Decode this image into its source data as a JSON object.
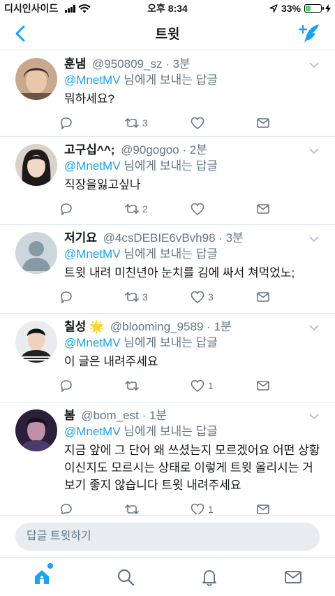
{
  "status_bar": {
    "carrier": "디시인사이드",
    "time": "오후 8:34",
    "battery": "33%",
    "battery_level": 0.33
  },
  "nav": {
    "title": "트윗"
  },
  "tweets": [
    {
      "name": "훈냄",
      "handle": "@950809_sz",
      "time": "· 3분",
      "mention": "@MnetMV",
      "reply_suffix": " 님에게 보내는 답글",
      "body": "뭐하세요?",
      "retweets": "3",
      "likes": ""
    },
    {
      "name": "고구십^^;",
      "handle": "@90gogoo",
      "time": "· 2분",
      "mention": "@MnetMV",
      "reply_suffix": " 님에게 보내는 답글",
      "body": "직장을잃고싶나",
      "retweets": "2",
      "likes": ""
    },
    {
      "name": "저기요",
      "handle": "@4csDEBIE6vBvh98",
      "time": "· 3분",
      "mention": "@MnetMV",
      "reply_suffix": " 님에게 보내는 답글",
      "body": "트윗 내려 미친년아 눈치를 김에 싸서 쳐먹었노;",
      "retweets": "3",
      "likes": "3"
    },
    {
      "name": "칠성 🌟",
      "handle": "@blooming_9589",
      "time": "· 1분",
      "mention": "@MnetMV",
      "reply_suffix": " 님에게 보내는 답글",
      "body": "이 글은 내려주세요",
      "retweets": "",
      "likes": "1"
    },
    {
      "name": "봄",
      "handle": "@bom_est",
      "time": "· 1분",
      "mention": "@MnetMV",
      "reply_suffix": " 님에게 보내는 답글",
      "body": "지금 앞에 그 단어 왜 쓰셨는지 모르겠어요 어떤 상황이신지도 모르시는 상태로 이렇게 트윗 올리시는 거 보기 좋지 않습니다 트윗 내려주세요",
      "retweets": "",
      "likes": "1"
    }
  ],
  "reply_bar": {
    "placeholder": "답글 트윗하기"
  },
  "colors": {
    "accent": "#1da1f2",
    "muted": "#657786"
  }
}
